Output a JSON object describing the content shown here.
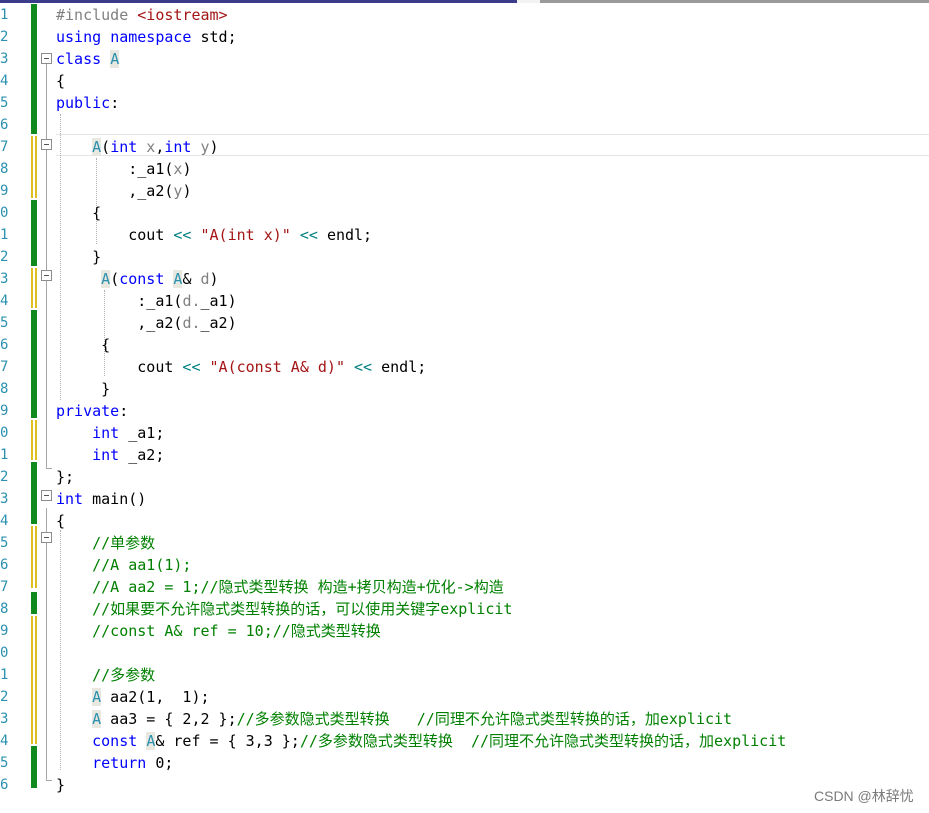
{
  "line_numbers": [
    "1",
    "2",
    "3",
    "4",
    "5",
    "6",
    "7",
    "8",
    "9",
    "0",
    "1",
    "2",
    "3",
    "4",
    "5",
    "6",
    "7",
    "8",
    "9",
    "0",
    "1",
    "2",
    "3",
    "4",
    "5",
    "6",
    "7",
    "8",
    "9",
    "0",
    "1",
    "2",
    "3",
    "4",
    "5",
    "6"
  ],
  "code": {
    "l1_directive": "#include",
    "l1_header": " <iostream>",
    "l2_using": "using",
    "l2_namespace": "namespace",
    "l2_rest": " std;",
    "l3_class": "class",
    "l3_name": "A",
    "l4": "{",
    "l5_public": "public",
    "l5_colon": ":",
    "l7_ctor": "A",
    "l7_paren": "(",
    "l7_int1": "int",
    "l7_x": " x",
    "l7_comma": ",",
    "l7_int2": "int",
    "l7_y": " y",
    "l7_close": ")",
    "l8_init": ":_a1(",
    "l8_arg": "x",
    "l8_close": ")",
    "l9_init": ",_a2(",
    "l9_arg": "y",
    "l9_close": ")",
    "l10": "{",
    "l11_cout": "cout",
    "l11_op1": " << ",
    "l11_str": "\"A(int x)\"",
    "l11_op2": " << ",
    "l11_end": "endl;",
    "l12": "}",
    "l13_ctor": "A",
    "l13_paren": "(",
    "l13_const": "const",
    "l13_type": "A",
    "l13_amp": "& ",
    "l13_d": "d",
    "l13_close": ")",
    "l14_init": ":_a1(",
    "l14_arg": "d.",
    "l14_rest": "_a1)",
    "l15_init": ",_a2(",
    "l15_arg": "d.",
    "l15_rest": "_a2)",
    "l16": "{",
    "l17_cout": "cout",
    "l17_op1": " << ",
    "l17_str": "\"A(const A& d)\"",
    "l17_op2": " << ",
    "l17_end": "endl;",
    "l18": "}",
    "l19_private": "private",
    "l19_colon": ":",
    "l20_int": "int",
    "l20_rest": " _a1;",
    "l21_int": "int",
    "l21_rest": " _a2;",
    "l22": "};",
    "l23_int": "int",
    "l23_rest": " main()",
    "l24": "{",
    "l25_comment": "//单参数",
    "l26_comment": "//A aa1(1);",
    "l27_comment": "//A aa2 = 1;//隐式类型转换 构造+拷贝构造+优化->构造",
    "l28_comment": "//如果要不允许隐式类型转换的话，可以使用关键字explicit",
    "l29_comment": "//const A& ref = 10;//隐式类型转换",
    "l31_comment": "//多参数",
    "l32_type": "A",
    "l32_rest": " aa2(1,  1);",
    "l33_type": "A",
    "l33_rest": " aa3 = { 2,2 };",
    "l33_comment": "//多参数隐式类型转换   //同理不允许隐式类型转换的话，加explicit",
    "l34_const": "const",
    "l34_type": "A",
    "l34_rest": "& ref = { 3,3 };",
    "l34_comment": "//多参数隐式类型转换  //同理不允许隐式类型转换的话，加explicit",
    "l35_return": "return",
    "l35_rest": " 0;",
    "l36": "}"
  },
  "watermark": "CSDN @林辞忧"
}
